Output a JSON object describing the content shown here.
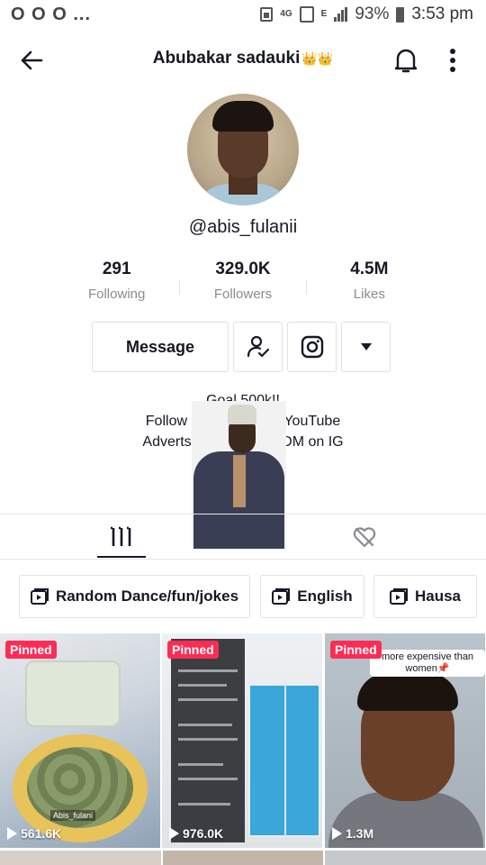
{
  "status_bar": {
    "left_dots": "O O O ...",
    "net_4g": "4G",
    "net_e": "E",
    "battery": "93%",
    "time": "3:53 pm"
  },
  "header": {
    "title": "Abubakar sadauki",
    "title_emoji": "👑👑"
  },
  "profile": {
    "username": "@abis_fulanii",
    "stats": [
      {
        "value": "291",
        "label": "Following"
      },
      {
        "value": "329.0K",
        "label": "Followers"
      },
      {
        "value": "4.5M",
        "label": "Likes"
      }
    ],
    "message_label": "Message",
    "bio": [
      "Goal 500k!!",
      "Follow me on Insta & YouTube",
      "Adverts and Inquiries DM on IG"
    ]
  },
  "playlists": [
    {
      "label": "Random Dance/fun/jokes"
    },
    {
      "label": "English"
    },
    {
      "label": "Hausa"
    }
  ],
  "videos": [
    {
      "pinned": "Pinned",
      "views": "561.6K",
      "tag": "Abis_fulani"
    },
    {
      "pinned": "Pinned",
      "views": "976.0K"
    },
    {
      "pinned": "Pinned",
      "views": "1.3M",
      "caption": "more expensive than women📌"
    }
  ],
  "colors": {
    "pinned": "#fe2c55",
    "text": "#161823",
    "muted": "#8a8b91"
  }
}
